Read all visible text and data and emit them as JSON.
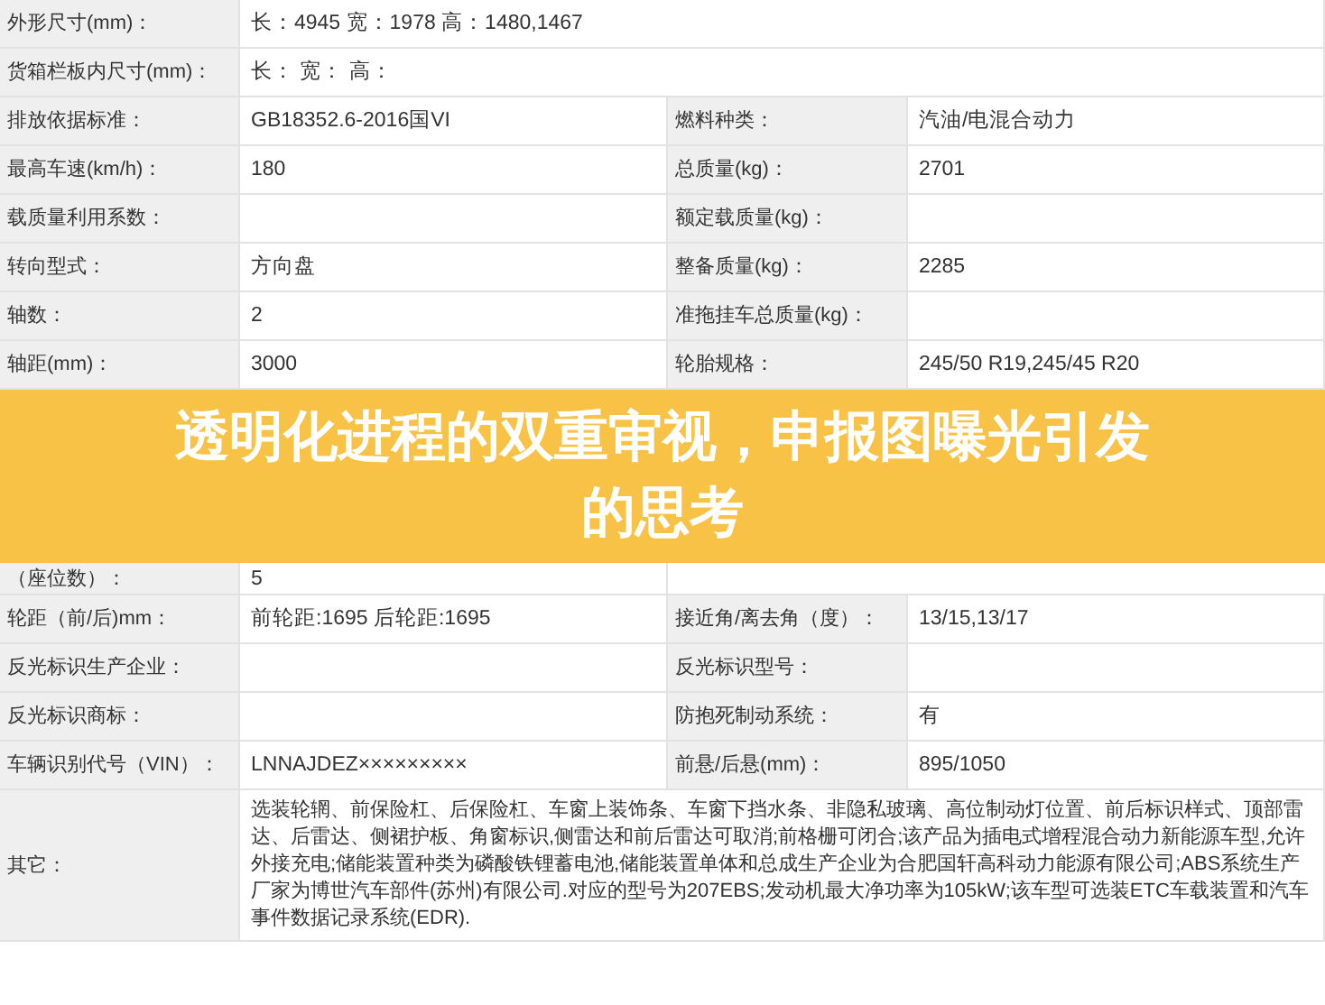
{
  "rows": [
    {
      "kind": "wide",
      "label": "外形尺寸(mm)：",
      "value": "长：4945 宽：1978 高：1480,1467"
    },
    {
      "kind": "wide",
      "label": "货箱栏板内尺寸(mm)：",
      "value": "长： 宽： 高："
    },
    {
      "kind": "pair",
      "label": "排放依据标准：",
      "value": "GB18352.6-2016国VI",
      "label_2": "燃料种类：",
      "value_2": "汽油/电混合动力"
    },
    {
      "kind": "pair",
      "label": "最高车速(km/h)：",
      "value": "180",
      "label_2": "总质量(kg)：",
      "value_2": "2701"
    },
    {
      "kind": "pair",
      "label": "载质量利用系数：",
      "label_2": "额定载质量(kg)："
    },
    {
      "kind": "pair",
      "label": "转向型式：",
      "value": "方向盘",
      "label_2": "整备质量(kg)：",
      "value_2": "2285"
    },
    {
      "kind": "pair",
      "label": "轴数：",
      "value": "2",
      "label_2": "准拖挂车总质量(kg)："
    },
    {
      "kind": "pair",
      "label": "轴距(mm)：",
      "value": "3000",
      "label_2": "轮胎规格：",
      "value_2": "245/50 R19,245/45 R20"
    },
    {
      "kind": "banner",
      "title": "透明化进程的双重审视，申报图曝光引发的思考"
    },
    {
      "kind": "partial",
      "label": "（座位数）：",
      "value": "5"
    },
    {
      "kind": "pair",
      "label": "轮距（前/后)mm：",
      "value": "前轮距:1695 后轮距:1695",
      "label_2": "接近角/离去角（度）：",
      "value_2": "13/15,13/17"
    },
    {
      "kind": "pair",
      "label": "反光标识生产企业：",
      "label_2": "反光标识型号："
    },
    {
      "kind": "pair",
      "label": "反光标识商标：",
      "label_2": "防抱死制动系统：",
      "value_2": "有"
    },
    {
      "kind": "pair",
      "label": "车辆识别代号（VIN）：",
      "value": "LNNAJDEZ×××××××××",
      "label_2": "前悬/后悬(mm)：",
      "value_2": "895/1050"
    },
    {
      "kind": "wide",
      "label": "其它：",
      "value": "选装轮辋、前保险杠、后保险杠、车窗上装饰条、车窗下挡水条、非隐私玻璃、高位制动灯位置、前后标识样式、顶部雷达、后雷达、侧裙护板、角窗标识,侧雷达和前后雷达可取消;前格栅可闭合;该产品为插电式增程混合动力新能源车型,允许外接充电;储能装置种类为磷酸铁锂蓄电池,储能装置单体和总成生产企业为合肥国轩高科动力能源有限公司;ABS系统生产厂家为博世汽车部件(苏州)有限公司.对应的型号为207EBS;发动机最大净功率为105kW;该车型可选装ETC车载装置和汽车事件数据记录系统(EDR)."
    }
  ]
}
